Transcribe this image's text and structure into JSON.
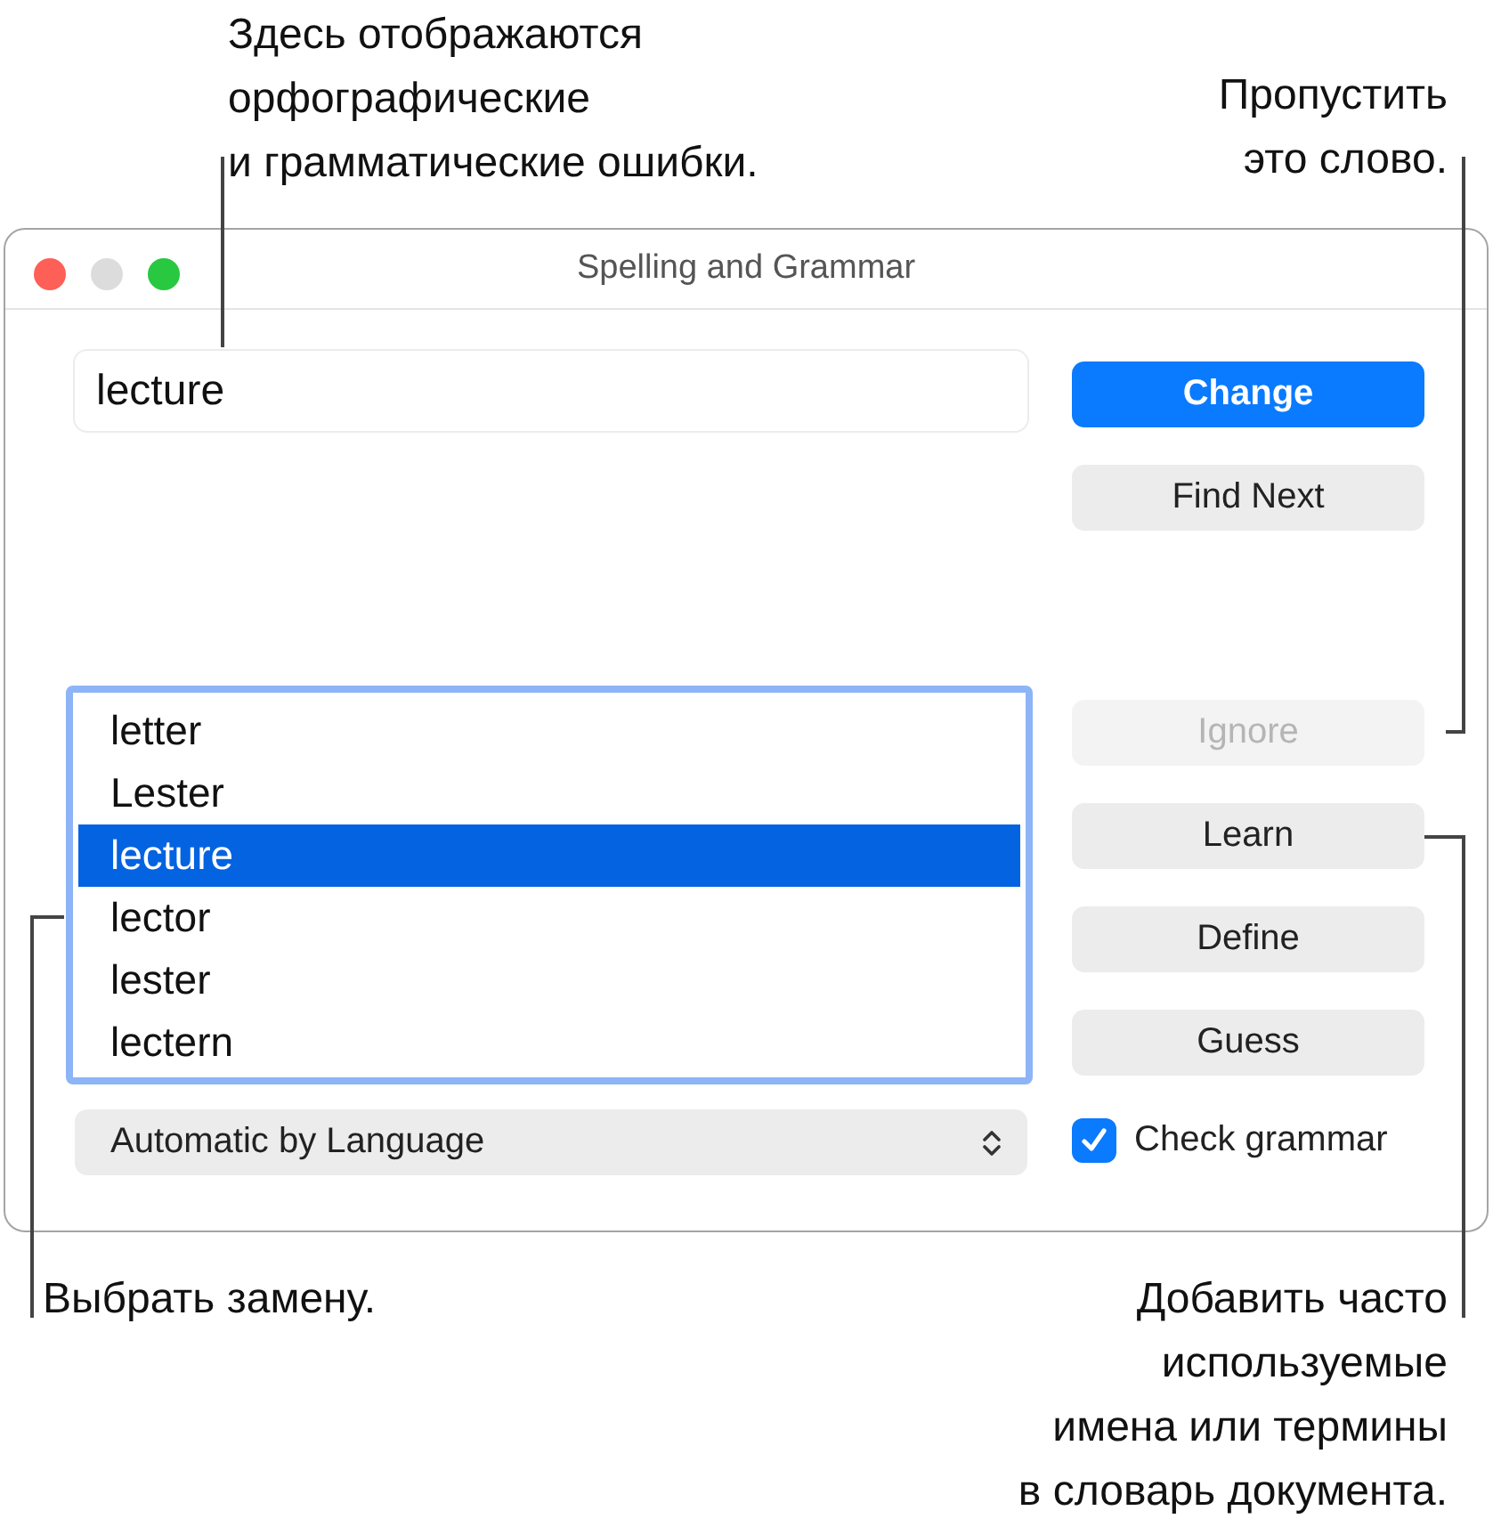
{
  "callouts": {
    "top_left": "Здесь отображаются\nорфографические\nи грамматические ошибки.",
    "top_right": "Пропустить\nэто слово.",
    "bottom_left": "Выбрать замену.",
    "bottom_right": "Добавить часто\nиспользуемые\nимена или термины\nв словарь документа."
  },
  "window": {
    "title": "Spelling and Grammar"
  },
  "word_field": {
    "value": "lecture"
  },
  "suggestions": [
    {
      "text": "letter",
      "selected": false
    },
    {
      "text": "Lester",
      "selected": false
    },
    {
      "text": "lecture",
      "selected": true
    },
    {
      "text": "lector",
      "selected": false
    },
    {
      "text": "lester",
      "selected": false
    },
    {
      "text": "lectern",
      "selected": false
    }
  ],
  "buttons_top": [
    {
      "label": "Change",
      "kind": "primary",
      "disabled": false
    },
    {
      "label": "Find Next",
      "kind": "normal",
      "disabled": false
    }
  ],
  "buttons_bottom": [
    {
      "label": "Ignore",
      "kind": "normal",
      "disabled": true
    },
    {
      "label": "Learn",
      "kind": "normal",
      "disabled": false
    },
    {
      "label": "Define",
      "kind": "normal",
      "disabled": false
    },
    {
      "label": "Guess",
      "kind": "normal",
      "disabled": false
    }
  ],
  "language_popup": {
    "value": "Automatic by Language"
  },
  "check_grammar": {
    "label": "Check grammar",
    "checked": true
  }
}
